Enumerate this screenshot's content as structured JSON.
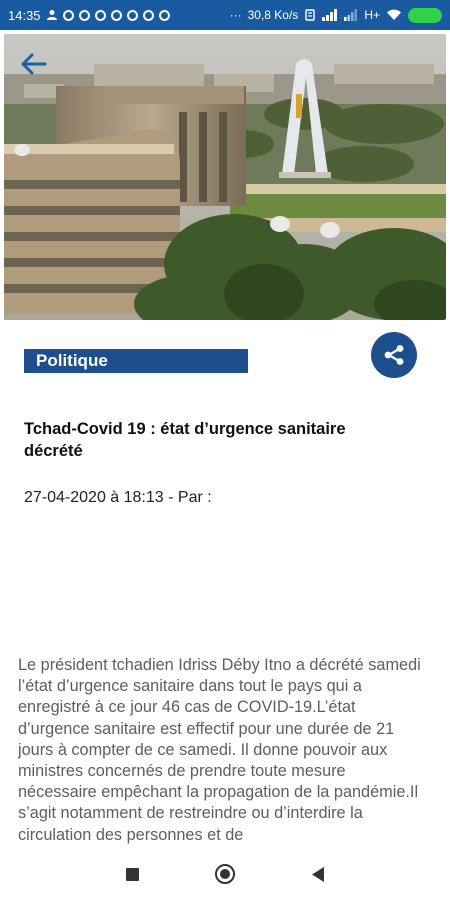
{
  "status_bar": {
    "time": "14:35",
    "speed": "30,8 Ko/s",
    "network": "H+",
    "battery": "",
    "notification_icons": [
      "person-icon",
      "facebook-icon",
      "facebook-icon",
      "facebook-icon",
      "facebook-icon",
      "facebook-icon",
      "facebook-icon"
    ],
    "more": "···"
  },
  "article": {
    "category": "Politique",
    "title": "Tchad-Covid 19 : état d’urgence sanitaire décrété",
    "date": "27-04-2020 à 18:13",
    "by_label": " - Par :",
    "body": "Le président tchadien Idriss Déby Itno a décrété samedi l’état d’urgence sanitaire dans tout le pays qui a enregistré à ce jour 46 cas de COVID-19.L’état d’urgence sanitaire est effectif pour une durée de 21 jours à compter de ce samedi. Il donne pouvoir aux ministres concernés de prendre toute mesure nécessaire empêchant la propagation de la pandémie.Il s’agit notamment de restreindre ou d’interdire la circulation des personnes et de"
  },
  "colors": {
    "status_bar": "#1a5aa0",
    "accent": "#1d4f8c",
    "battery": "#2fd34a"
  },
  "icons": {
    "back": "arrow-left-icon",
    "share": "share-icon",
    "nav_recent": "square-icon",
    "nav_home": "circle-icon",
    "nav_back": "triangle-left-icon"
  }
}
